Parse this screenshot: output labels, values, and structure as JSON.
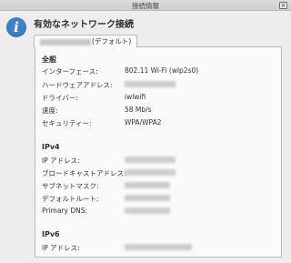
{
  "window": {
    "title": "接続情報",
    "close_glyph": "×"
  },
  "heading": "有効なネットワーク接続",
  "icon": "info-icon",
  "tab": {
    "label_suffix": "(デフォルト)"
  },
  "general": {
    "title": "全般",
    "rows": [
      {
        "label": "インターフェース:",
        "value": "802.11 Wi-Fi (wlp2s0)"
      },
      {
        "label": "ハードウェアアドレス:",
        "value": ""
      },
      {
        "label": "ドライバー:",
        "value": "iwlwifi"
      },
      {
        "label": "速度:",
        "value": "58 Mb/s"
      },
      {
        "label": "セキュリティー:",
        "value": "WPA/WPA2"
      }
    ]
  },
  "ipv4": {
    "title": "IPv4",
    "rows": [
      {
        "label": "IP アドレス:",
        "value": ""
      },
      {
        "label": "ブロードキャストアドレス:",
        "value": ""
      },
      {
        "label": "サブネットマスク:",
        "value": ""
      },
      {
        "label": "デフォルトルート:",
        "value": ""
      },
      {
        "label": "Primary DNS:",
        "value": ""
      }
    ]
  },
  "ipv6": {
    "title": "IPv6",
    "rows": [
      {
        "label": "IP アドレス:",
        "value": ""
      }
    ]
  }
}
